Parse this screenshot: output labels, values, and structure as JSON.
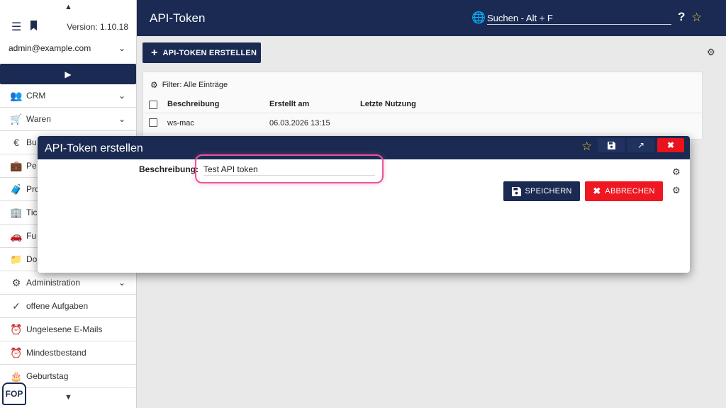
{
  "sidebar": {
    "version": "Version: 1.10.18",
    "user": "admin@example.com",
    "items": [
      {
        "label": "CRM",
        "icon": "people-icon"
      },
      {
        "label": "Waren",
        "icon": "cart-icon"
      },
      {
        "label": "Bu",
        "icon": "euro-icon"
      },
      {
        "label": "Pe",
        "icon": "briefcase-icon"
      },
      {
        "label": "Pro",
        "icon": "suitcase-icon"
      },
      {
        "label": "Tic",
        "icon": "building-icon"
      },
      {
        "label": "Fu",
        "icon": "car-icon"
      },
      {
        "label": "Do",
        "icon": "folder-icon"
      },
      {
        "label": "Administration",
        "icon": "gear-icon"
      },
      {
        "label": "offene Aufgaben",
        "icon": "check-icon"
      },
      {
        "label": "Ungelesene E-Mails",
        "icon": "alarm-icon"
      },
      {
        "label": "Mindestbestand",
        "icon": "alarm-icon"
      },
      {
        "label": "Geburtstag",
        "icon": "cake-icon"
      }
    ],
    "logo": "FOP"
  },
  "topbar": {
    "title": "API-Token",
    "search_placeholder": "Suchen - Alt + F",
    "help": "?"
  },
  "main": {
    "create_label": "API-TOKEN ERSTELLEN",
    "filter": "Filter: Alle Einträge",
    "columns": [
      "Beschreibung",
      "Erstellt am",
      "Letzte Nutzung"
    ],
    "rows": [
      {
        "beschreibung": "ws-mac",
        "erstellt": "06.03.2026 13:15",
        "letzte": ""
      }
    ]
  },
  "modal": {
    "title": "API-Token erstellen",
    "field_label": "Beschreibung:",
    "field_value": "Test API token",
    "save_label": "SPEICHERN",
    "cancel_label": "ABBRECHEN"
  },
  "colors": {
    "navy": "#1a2a52",
    "red": "#ee1722",
    "star": "#f0d32a",
    "highlight": "#e8559a"
  }
}
